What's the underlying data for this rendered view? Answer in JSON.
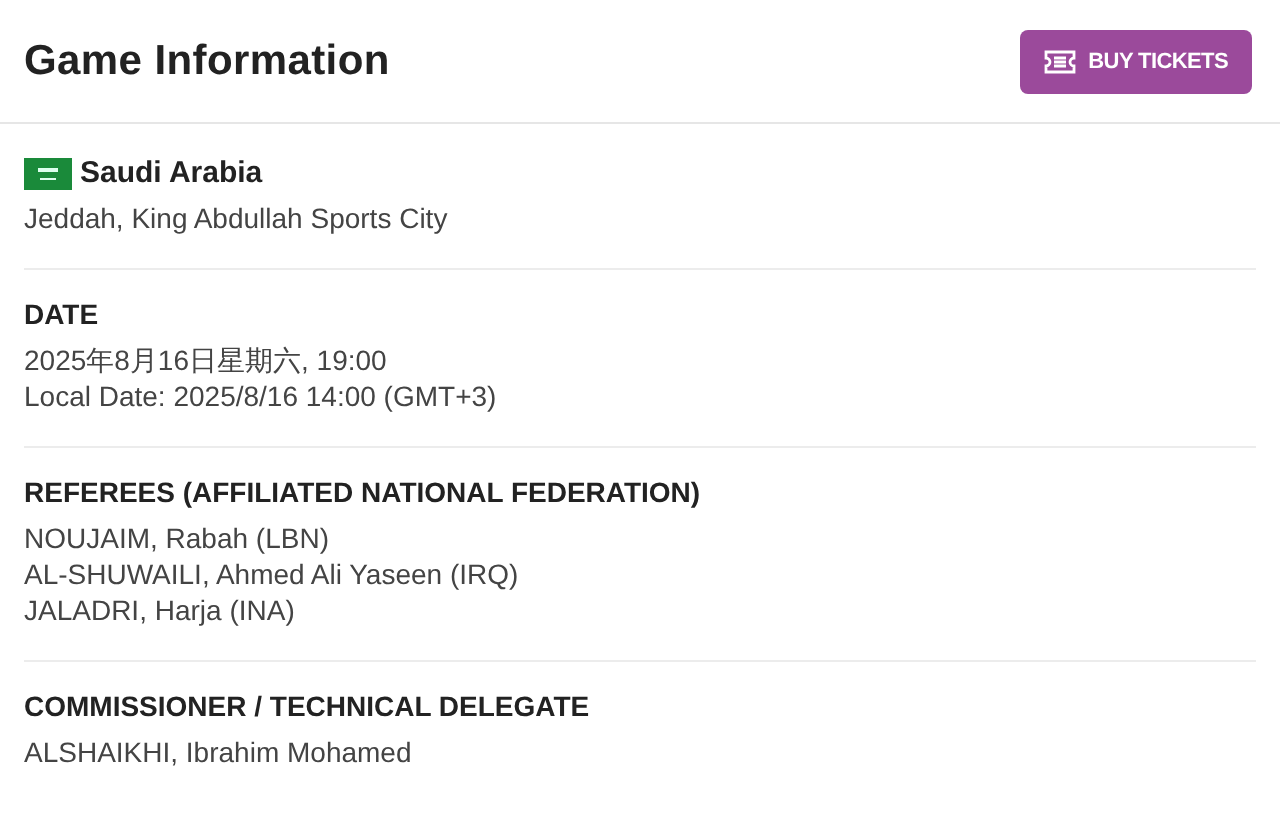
{
  "header": {
    "title": "Game Information",
    "button": "BUY TICKETS"
  },
  "venue": {
    "country": "Saudi Arabia",
    "city": "Jeddah, King Abdullah Sports City"
  },
  "sections": [
    {
      "heading": "DATE",
      "lines": [
        "2025年8月16日星期六, 19:00",
        "Local Date: 2025/8/16 14:00 (GMT+3)"
      ]
    },
    {
      "heading": "REFEREES (AFFILIATED NATIONAL FEDERATION)",
      "lines": [
        "NOUJAIM, Rabah (LBN)",
        "AL-SHUWAILI, Ahmed Ali Yaseen (IRQ)",
        "JALADRI, Harja (INA)"
      ]
    },
    {
      "heading": "COMMISSIONER / TECHNICAL DELEGATE",
      "lines": [
        "ALSHAIKHI, Ibrahim Mohamed"
      ]
    }
  ]
}
